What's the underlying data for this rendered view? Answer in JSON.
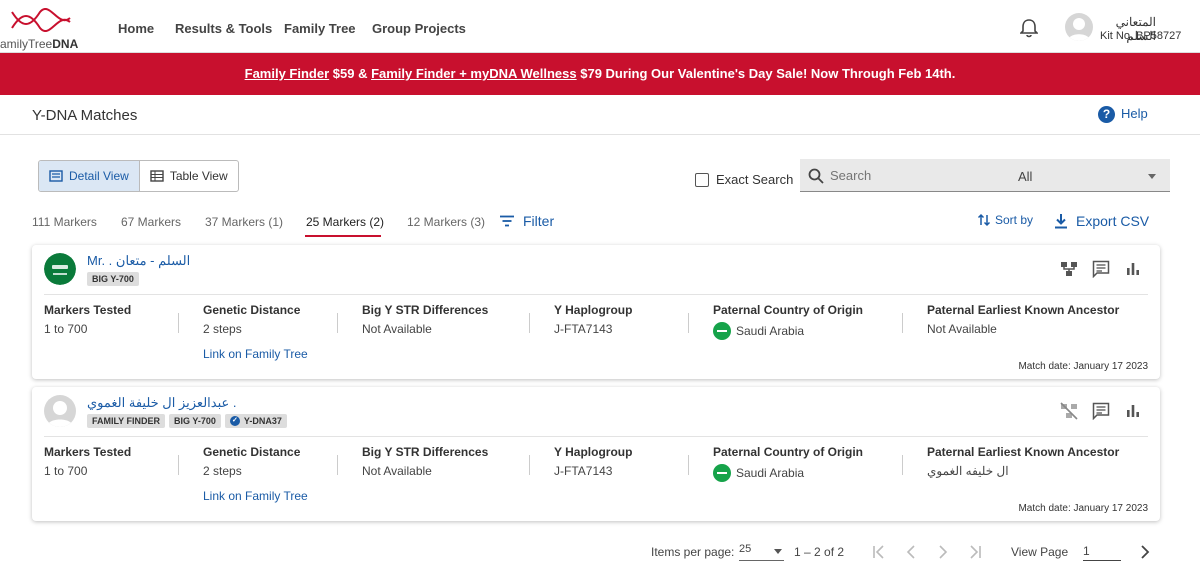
{
  "nav": {
    "logo_text_prefix": "amilyTree",
    "logo_text_suffix": "DNA",
    "links": [
      "Home",
      "Results & Tools",
      "Family Tree",
      "Group Projects"
    ],
    "user_name": "المتعاني السلم",
    "kit_no": "Kit No. BP58727"
  },
  "banner": {
    "link1": "Family Finder",
    "text1": " $59 & ",
    "link2": "Family Finder + myDNA Wellness",
    "text2": " $79 During Our Valentine's Day Sale! Now Through Feb 14th."
  },
  "header": {
    "title": "Y-DNA Matches",
    "help_label": "Help"
  },
  "toolbar": {
    "detail_view": "Detail View",
    "table_view": "Table View",
    "exact_search": "Exact Search",
    "search_placeholder": "Search",
    "search_scope": "All",
    "marker_tabs": [
      "111 Markers",
      "67 Markers",
      "37 Markers (1)",
      "25 Markers (2)",
      "12 Markers (3)"
    ],
    "active_tab": "25 Markers (2)",
    "filter": "Filter",
    "sort_by": "Sort by",
    "export_csv": "Export CSV"
  },
  "matches": [
    {
      "name": "Mr. . السلم - متعان",
      "badges": [
        "BIG Y-700"
      ],
      "labels": [
        "Markers Tested",
        "Genetic Distance",
        "Big Y STR Differences",
        "Y Haplogroup",
        "Paternal Country of Origin",
        "Paternal Earliest Known Ancestor"
      ],
      "markers_tested": "1 to 700",
      "genetic_distance": "2 steps",
      "family_tree_link": "Link on Family Tree",
      "big_y_str": "Not Available",
      "haplogroup": "J-FTA7143",
      "country": "Saudi Arabia",
      "ancestor": "Not Available",
      "match_date": "Match date: January 17 2023"
    },
    {
      "name": "عبدالعزيز ال خليفة الغموي .",
      "badges": [
        "FAMILY FINDER",
        "BIG Y-700"
      ],
      "verified_badge": "Y-DNA37",
      "labels": [
        "Markers Tested",
        "Genetic Distance",
        "Big Y STR Differences",
        "Y Haplogroup",
        "Paternal Country of Origin",
        "Paternal Earliest Known Ancestor"
      ],
      "markers_tested": "1 to 700",
      "genetic_distance": "2 steps",
      "family_tree_link": "Link on Family Tree",
      "big_y_str": "Not Available",
      "haplogroup": "J-FTA7143",
      "country": "Saudi Arabia",
      "ancestor": "ال خليفه الغموي",
      "match_date": "Match date: January 17 2023"
    }
  ],
  "pager": {
    "items_per_page_label": "Items per page:",
    "items_per_page": "25",
    "range": "1 – 2 of 2",
    "view_page_label": "View Page",
    "page": "1"
  },
  "colors": {
    "brand_red": "#c8102e",
    "link_blue": "#1a5ba6",
    "flag_green": "#16a34a"
  }
}
